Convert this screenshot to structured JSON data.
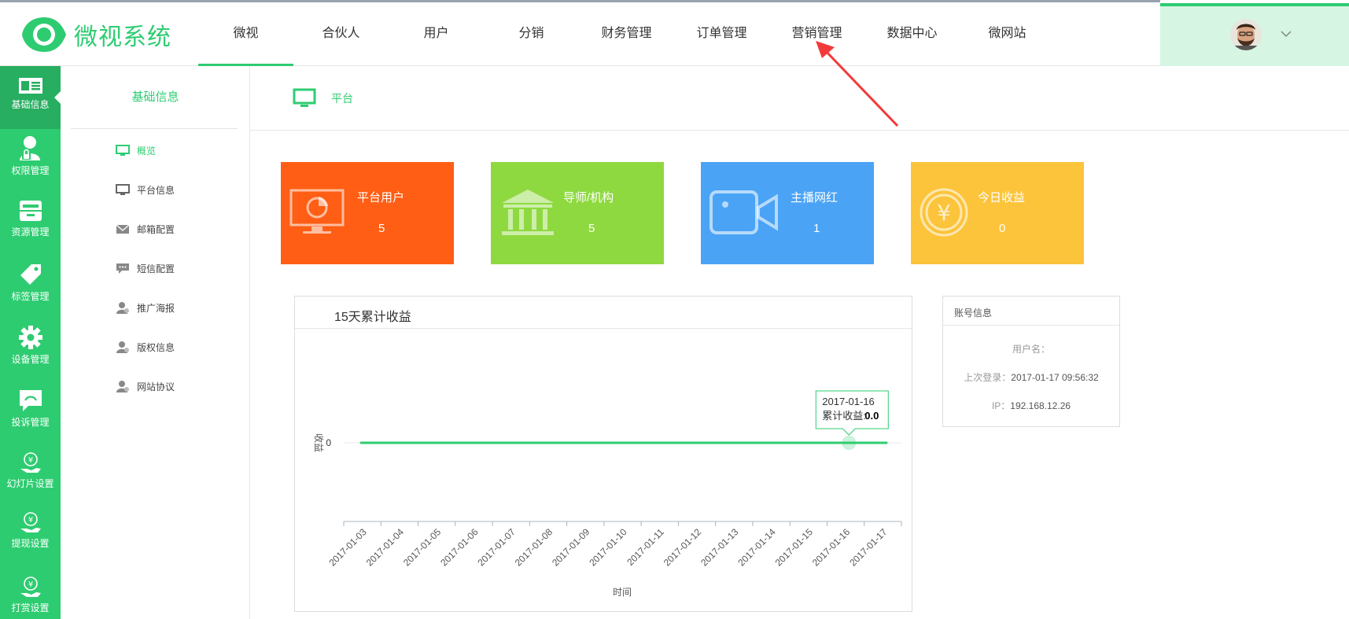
{
  "app": {
    "name": "微视系统"
  },
  "nav": {
    "items": [
      "微视",
      "合伙人",
      "用户",
      "分销",
      "财务管理",
      "订单管理",
      "营销管理",
      "数据中心",
      "微网站"
    ],
    "active_index": 0
  },
  "sidebar": {
    "items": [
      {
        "label": "基础信息",
        "icon": "id-card-icon"
      },
      {
        "label": "权限管理",
        "icon": "user-lock-icon"
      },
      {
        "label": "资源管理",
        "icon": "box-icon"
      },
      {
        "label": "标签管理",
        "icon": "tag-icon"
      },
      {
        "label": "设备管理",
        "icon": "gear-icon"
      },
      {
        "label": "投诉管理",
        "icon": "chat-icon"
      },
      {
        "label": "幻灯片设置",
        "icon": "coin-hand-icon"
      },
      {
        "label": "提现设置",
        "icon": "coin-hand-icon"
      },
      {
        "label": "打赏设置",
        "icon": "coin-hand-icon"
      }
    ],
    "active_index": 0
  },
  "subnav": {
    "title": "基础信息",
    "items": [
      {
        "label": "概览",
        "icon": "monitor-icon"
      },
      {
        "label": "平台信息",
        "icon": "monitor-icon"
      },
      {
        "label": "邮箱配置",
        "icon": "mail-icon"
      },
      {
        "label": "短信配置",
        "icon": "sms-icon"
      },
      {
        "label": "推广海报",
        "icon": "user-icon"
      },
      {
        "label": "版权信息",
        "icon": "user-icon"
      },
      {
        "label": "网站协议",
        "icon": "user-icon"
      }
    ],
    "active_index": 0
  },
  "page": {
    "title": "平台"
  },
  "stats": [
    {
      "label": "平台用户",
      "value": "5",
      "color": "#ff5e14",
      "icon": "monitor-pie-icon"
    },
    {
      "label": "导师/机构",
      "value": "5",
      "color": "#8fd940",
      "icon": "bank-icon"
    },
    {
      "label": "主播网红",
      "value": "1",
      "color": "#4aa3f5",
      "icon": "video-camera-icon"
    },
    {
      "label": "今日收益",
      "value": "0",
      "color": "#fcc43b",
      "icon": "yen-coin-icon"
    }
  ],
  "chart_data": {
    "type": "line",
    "title": "15天累计收益",
    "xlabel": "时间",
    "ylabel": "收益",
    "x": [
      "2017-01-03",
      "2017-01-04",
      "2017-01-05",
      "2017-01-06",
      "2017-01-07",
      "2017-01-08",
      "2017-01-09",
      "2017-01-10",
      "2017-01-11",
      "2017-01-12",
      "2017-01-13",
      "2017-01-14",
      "2017-01-15",
      "2017-01-16",
      "2017-01-17"
    ],
    "series": [
      {
        "name": "累计收益",
        "values": [
          0,
          0,
          0,
          0,
          0,
          0,
          0,
          0,
          0,
          0,
          0,
          0,
          0,
          0,
          0
        ]
      }
    ],
    "y_ticks": [
      "0"
    ],
    "color": "#2ecc71",
    "tooltip": {
      "date": "2017-01-16",
      "label": "累计收益:",
      "value": "0.0",
      "index": 13
    }
  },
  "account": {
    "title": "账号信息",
    "username_label": "用户名：",
    "username": "",
    "last_login_label": "上次登录：",
    "last_login": "2017-01-17 09:56:32",
    "ip_label": "IP：",
    "ip": "192.168.12.26"
  }
}
